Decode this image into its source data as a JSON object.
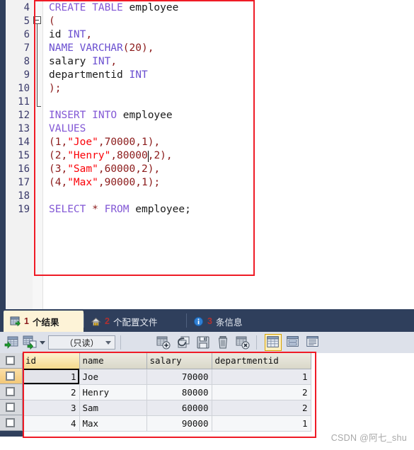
{
  "editor": {
    "first_line_number": 4,
    "lines": [
      {
        "n": 4,
        "tokens": [
          {
            "t": "CREATE",
            "c": "kw"
          },
          {
            "t": " ",
            "c": "plain"
          },
          {
            "t": "TABLE",
            "c": "kw"
          },
          {
            "t": " ",
            "c": "plain"
          },
          {
            "t": "employee",
            "c": "id"
          }
        ]
      },
      {
        "n": 5,
        "tokens": [
          {
            "t": "(",
            "c": "pun"
          }
        ]
      },
      {
        "n": 6,
        "tokens": [
          {
            "t": "id",
            "c": "id"
          },
          {
            "t": " ",
            "c": "plain"
          },
          {
            "t": "INT",
            "c": "typ"
          },
          {
            "t": ",",
            "c": "pun"
          }
        ]
      },
      {
        "n": 7,
        "tokens": [
          {
            "t": "NAME",
            "c": "typ"
          },
          {
            "t": " ",
            "c": "plain"
          },
          {
            "t": "VARCHAR",
            "c": "typ"
          },
          {
            "t": "(",
            "c": "pun"
          },
          {
            "t": "20",
            "c": "num"
          },
          {
            "t": "),",
            "c": "pun"
          }
        ]
      },
      {
        "n": 8,
        "tokens": [
          {
            "t": "salary",
            "c": "id"
          },
          {
            "t": " ",
            "c": "plain"
          },
          {
            "t": "INT",
            "c": "typ"
          },
          {
            "t": ",",
            "c": "pun"
          }
        ]
      },
      {
        "n": 9,
        "tokens": [
          {
            "t": "departmentid",
            "c": "id"
          },
          {
            "t": " ",
            "c": "plain"
          },
          {
            "t": "INT",
            "c": "typ"
          }
        ]
      },
      {
        "n": 10,
        "tokens": [
          {
            "t": ");",
            "c": "pun"
          }
        ]
      },
      {
        "n": 11,
        "tokens": []
      },
      {
        "n": 12,
        "tokens": [
          {
            "t": "INSERT",
            "c": "kw"
          },
          {
            "t": " ",
            "c": "plain"
          },
          {
            "t": "INTO",
            "c": "kw"
          },
          {
            "t": " ",
            "c": "plain"
          },
          {
            "t": "employee",
            "c": "id"
          }
        ]
      },
      {
        "n": 13,
        "tokens": [
          {
            "t": "VALUES",
            "c": "kw"
          }
        ]
      },
      {
        "n": 14,
        "tokens": [
          {
            "t": "(",
            "c": "pun"
          },
          {
            "t": "1",
            "c": "num"
          },
          {
            "t": ",",
            "c": "pun"
          },
          {
            "t": "\"Joe\"",
            "c": "str"
          },
          {
            "t": ",",
            "c": "pun"
          },
          {
            "t": "70000",
            "c": "num"
          },
          {
            "t": ",",
            "c": "pun"
          },
          {
            "t": "1",
            "c": "num"
          },
          {
            "t": "),",
            "c": "pun"
          }
        ]
      },
      {
        "n": 15,
        "tokens": [
          {
            "t": "(",
            "c": "pun"
          },
          {
            "t": "2",
            "c": "num"
          },
          {
            "t": ",",
            "c": "pun"
          },
          {
            "t": "\"Henry\"",
            "c": "str"
          },
          {
            "t": ",",
            "c": "pun"
          },
          {
            "t": "80000",
            "c": "num"
          },
          {
            "t": ",",
            "c": "pun"
          },
          {
            "t": "2",
            "c": "num"
          },
          {
            "t": "),",
            "c": "pun"
          }
        ]
      },
      {
        "n": 16,
        "tokens": [
          {
            "t": "(",
            "c": "pun"
          },
          {
            "t": "3",
            "c": "num"
          },
          {
            "t": ",",
            "c": "pun"
          },
          {
            "t": "\"Sam\"",
            "c": "str"
          },
          {
            "t": ",",
            "c": "pun"
          },
          {
            "t": "60000",
            "c": "num"
          },
          {
            "t": ",",
            "c": "pun"
          },
          {
            "t": "2",
            "c": "num"
          },
          {
            "t": "),",
            "c": "pun"
          }
        ]
      },
      {
        "n": 17,
        "tokens": [
          {
            "t": "(",
            "c": "pun"
          },
          {
            "t": "4",
            "c": "num"
          },
          {
            "t": ",",
            "c": "pun"
          },
          {
            "t": "\"Max\"",
            "c": "str"
          },
          {
            "t": ",",
            "c": "pun"
          },
          {
            "t": "90000",
            "c": "num"
          },
          {
            "t": ",",
            "c": "pun"
          },
          {
            "t": "1",
            "c": "num"
          },
          {
            "t": ");",
            "c": "pun"
          }
        ]
      },
      {
        "n": 18,
        "tokens": []
      },
      {
        "n": 19,
        "tokens": [
          {
            "t": "SELECT",
            "c": "kw"
          },
          {
            "t": " ",
            "c": "plain"
          },
          {
            "t": "*",
            "c": "pun"
          },
          {
            "t": " ",
            "c": "plain"
          },
          {
            "t": "FROM",
            "c": "kw"
          },
          {
            "t": " ",
            "c": "plain"
          },
          {
            "t": "employee;",
            "c": "id"
          }
        ]
      }
    ],
    "caret_line": 15,
    "fold_marker": "collapse-fold-icon"
  },
  "tabs": [
    {
      "id": "results",
      "count": "1",
      "label": "个结果",
      "icon": "result-grid-icon",
      "active": true
    },
    {
      "id": "profiles",
      "count": "2",
      "label": "个配置文件",
      "icon": "profile-icon",
      "active": false
    },
    {
      "id": "messages",
      "count": "3",
      "label": "条信息",
      "icon": "info-icon",
      "active": false
    }
  ],
  "toolbar": {
    "buttons": [
      {
        "id": "open-grid",
        "icon": "grid-import-icon"
      },
      {
        "id": "export-grid",
        "icon": "grid-export-icon"
      },
      {
        "id": "dropdown",
        "icon": "chevron-down-icon"
      }
    ],
    "mode_select": {
      "value": "（只读）",
      "icon": "chevron-down-icon"
    },
    "actions": [
      {
        "id": "add-record",
        "icon": "add-record-icon"
      },
      {
        "id": "refresh",
        "icon": "refresh-icon"
      },
      {
        "id": "save",
        "icon": "floppy-save-icon"
      },
      {
        "id": "delete",
        "icon": "trash-icon"
      },
      {
        "id": "remove-record",
        "icon": "remove-record-icon"
      }
    ],
    "view_modes": [
      {
        "id": "grid-view",
        "icon": "grid-view-icon",
        "active": true
      },
      {
        "id": "form-view",
        "icon": "form-view-icon",
        "active": false
      },
      {
        "id": "text-view",
        "icon": "text-view-icon",
        "active": false
      }
    ]
  },
  "grid": {
    "columns": [
      {
        "key": "id",
        "label": "id",
        "align": "right",
        "active": true
      },
      {
        "key": "name",
        "label": "name",
        "align": "left",
        "active": false
      },
      {
        "key": "salary",
        "label": "salary",
        "align": "right",
        "active": false
      },
      {
        "key": "departmentid",
        "label": "departmentid",
        "align": "right",
        "active": false
      }
    ],
    "rows": [
      {
        "id": "1",
        "name": "Joe",
        "salary": "70000",
        "departmentid": "1"
      },
      {
        "id": "2",
        "name": "Henry",
        "salary": "80000",
        "departmentid": "2"
      },
      {
        "id": "3",
        "name": "Sam",
        "salary": "60000",
        "departmentid": "2"
      },
      {
        "id": "4",
        "name": "Max",
        "salary": "90000",
        "departmentid": "1"
      }
    ],
    "selected_row": 0,
    "selected_column": "id"
  },
  "watermark": {
    "text": "CSDN @阿七_shu"
  },
  "colors": {
    "keyword": "#8257d5",
    "type": "#6a4fd0",
    "string": "#fb0007",
    "number": "#8b1a1a",
    "annotation": "#ef1b26",
    "panel_dark": "#2f3f5c",
    "active_tab": "#fdf3d7"
  }
}
